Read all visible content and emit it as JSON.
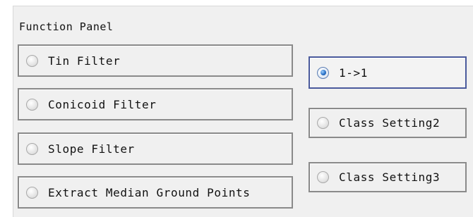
{
  "panel": {
    "title": "Function Panel"
  },
  "filters": [
    {
      "label": "Tin Filter",
      "checked": false
    },
    {
      "label": "Conicoid Filter",
      "checked": false
    },
    {
      "label": "Slope Filter",
      "checked": false
    },
    {
      "label": "Extract Median Ground Points",
      "checked": false
    }
  ],
  "options": [
    {
      "label": "1->1",
      "checked": true
    },
    {
      "label": "Class Setting2",
      "checked": false
    },
    {
      "label": "Class Setting3",
      "checked": false
    }
  ],
  "colors": {
    "panel_bg": "#f0f0f0",
    "box_border": "#8a8a8a",
    "selected_border": "#4a5a9c",
    "radio_dot": "#2a72c8"
  }
}
